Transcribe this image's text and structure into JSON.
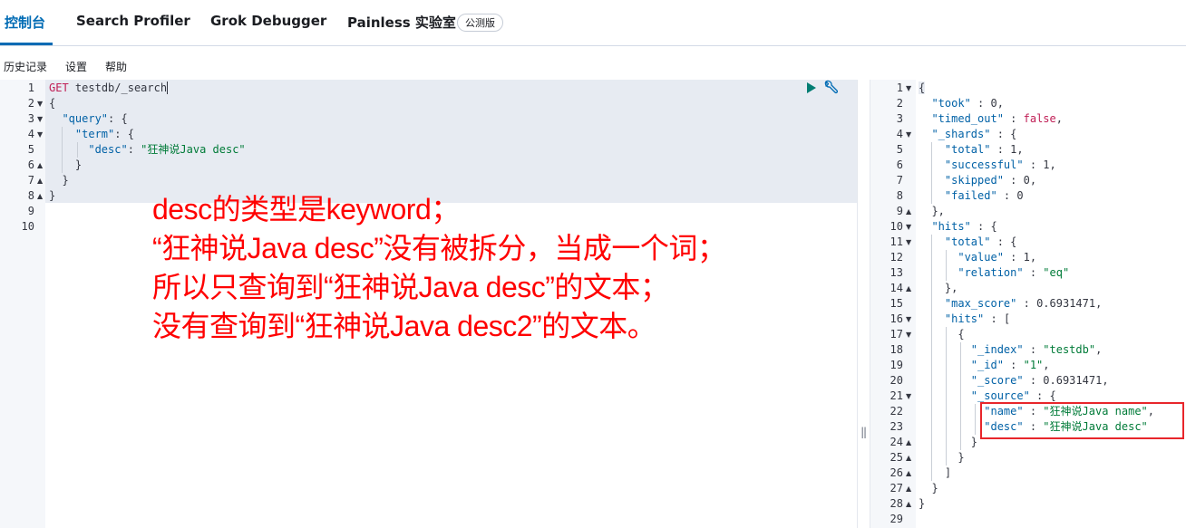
{
  "tabs": [
    {
      "label": "控制台",
      "active": true
    },
    {
      "label": "Search Profiler",
      "active": false
    },
    {
      "label": "Grok Debugger",
      "active": false
    },
    {
      "label": "Painless 实验室",
      "active": false
    }
  ],
  "beta_badge": "公测版",
  "menu": {
    "history": "历史记录",
    "settings": "设置",
    "help": "帮助"
  },
  "request": {
    "method": "GET",
    "path": "testdb/_search",
    "line_numbers": [
      "1",
      "2",
      "3",
      "4",
      "5",
      "6",
      "7",
      "8",
      "9",
      "10"
    ],
    "query_key": "\"query\"",
    "term_key": "\"term\"",
    "desc_key": "\"desc\"",
    "desc_value": "\"狂神说Java desc\""
  },
  "response": {
    "line_numbers": [
      "1",
      "2",
      "3",
      "4",
      "5",
      "6",
      "7",
      "8",
      "9",
      "10",
      "11",
      "12",
      "13",
      "14",
      "15",
      "16",
      "17",
      "18",
      "19",
      "20",
      "21",
      "22",
      "23",
      "24",
      "25",
      "26",
      "27",
      "28",
      "29"
    ],
    "took": "0",
    "timed_out": "false",
    "shards_total": "1",
    "shards_successful": "1",
    "shards_skipped": "0",
    "shards_failed": "0",
    "hits_total_value": "1",
    "hits_total_relation": "\"eq\"",
    "max_score": "0.6931471",
    "hit_index": "\"testdb\"",
    "hit_id": "\"1\"",
    "hit_score": "0.6931471",
    "source_name": "\"狂神说Java name\"",
    "source_desc": "\"狂神说Java desc\""
  },
  "annotation": [
    "desc的类型是keyword；",
    "“狂神说Java desc”没有被拆分，当成一个词；",
    "所以只查询到“狂神说Java desc”的文本；",
    "没有查询到“狂神说Java desc2”的文本。"
  ],
  "colors": {
    "accent": "#006bb4",
    "annotation": "#ff0000",
    "highlight_box": "#e8262b",
    "run": "#017d73"
  },
  "icons": {
    "run": "play-icon",
    "settings": "wrench-icon"
  }
}
